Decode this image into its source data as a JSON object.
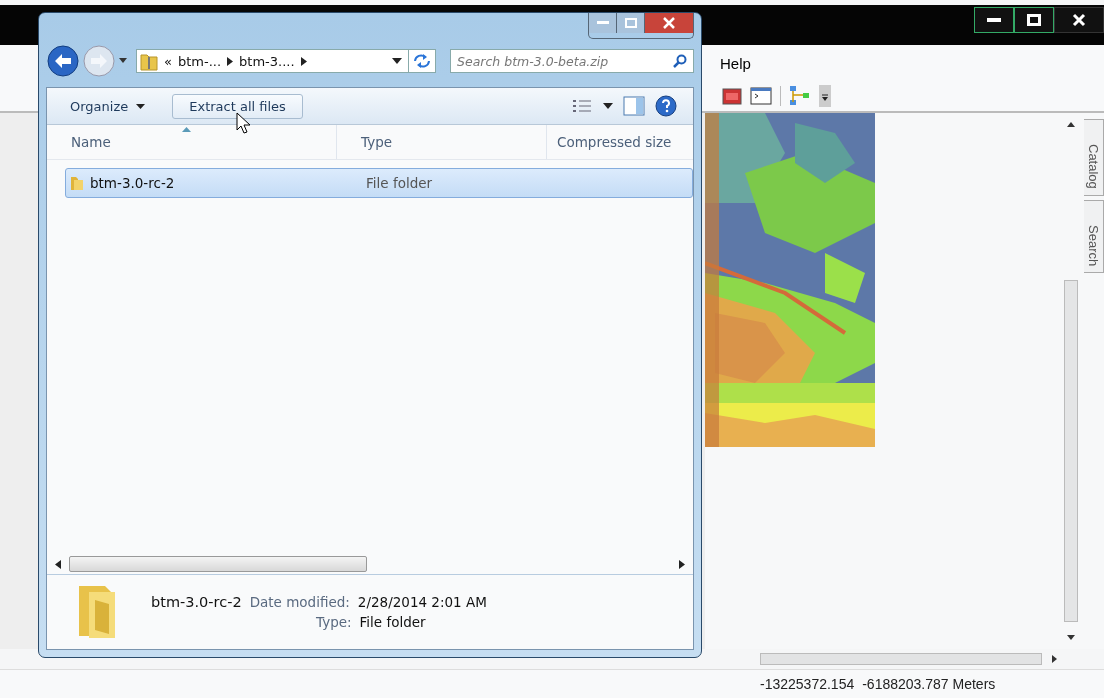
{
  "app_window": {
    "menu": [
      {
        "label": "Help"
      }
    ],
    "side_tabs": [
      {
        "label": "Catalog"
      },
      {
        "label": "Search"
      }
    ],
    "status_bar": {
      "x_coordinate": "-13225372.154",
      "y_coordinate": "-6188203.787 Meters"
    }
  },
  "explorer": {
    "breadcrumb_prefix": "«",
    "breadcrumbs": [
      "btm-...",
      "btm-3...."
    ],
    "search": {
      "placeholder": "Search btm-3.0-beta.zip"
    },
    "commands": [
      {
        "label": "Organize",
        "kind": "menu"
      },
      {
        "label": "Extract all files",
        "kind": "button"
      }
    ],
    "columns": [
      "Name",
      "Type",
      "Compressed size"
    ],
    "rows": [
      {
        "name": "btm-3.0-rc-2",
        "type": "File folder",
        "selected": true
      }
    ],
    "details": {
      "name": "btm-3.0-rc-2",
      "fields": [
        {
          "label": "Date modified:",
          "value": "2/28/2014 2:01 AM"
        },
        {
          "label": "Type:",
          "value": "File folder"
        }
      ]
    }
  }
}
